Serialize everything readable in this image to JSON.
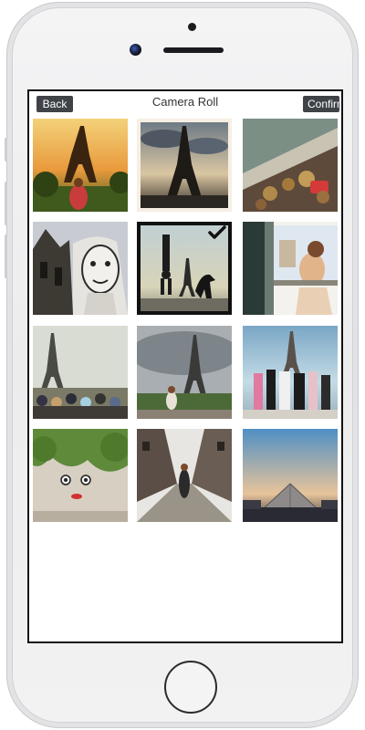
{
  "navbar": {
    "back_label": "Back",
    "title": "Camera Roll",
    "confirm_label": "Confirm"
  },
  "photos": [
    {
      "subject": "eiffel-tower-sunset-girl",
      "selected": false
    },
    {
      "subject": "eiffel-tower-silhouette",
      "selected": false
    },
    {
      "subject": "love-locks-bridge",
      "selected": false
    },
    {
      "subject": "notre-dame-street-art",
      "selected": false
    },
    {
      "subject": "handstand-dinosaur-eiffel",
      "selected": true
    },
    {
      "subject": "window-girl",
      "selected": false
    },
    {
      "subject": "eiffel-tower-crowd",
      "selected": false
    },
    {
      "subject": "eiffel-tower-cloudy",
      "selected": false
    },
    {
      "subject": "girls-group-eiffel",
      "selected": false
    },
    {
      "subject": "ivy-wall-face",
      "selected": false
    },
    {
      "subject": "cobblestone-street-girl",
      "selected": false
    },
    {
      "subject": "louvre-pyramid",
      "selected": false
    }
  ],
  "icons": {
    "checkmark": "checkmark-icon"
  }
}
